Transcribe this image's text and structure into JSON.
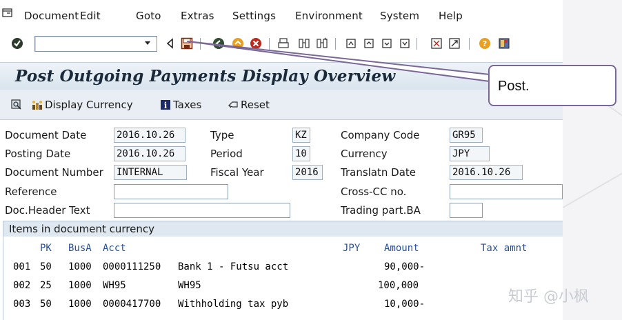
{
  "menu": {
    "items": [
      {
        "label": "Document"
      },
      {
        "label": "Edit"
      },
      {
        "label": "Goto"
      },
      {
        "label": "Extras"
      },
      {
        "label": "Settings"
      },
      {
        "label": "Environment"
      },
      {
        "label": "System"
      },
      {
        "label": "Help"
      }
    ]
  },
  "toolbar": {
    "command_value": ""
  },
  "title": "Post Outgoing Payments Display Overview",
  "app_toolbar": {
    "display_currency": "Display Currency",
    "taxes": "Taxes",
    "reset": "Reset"
  },
  "header": {
    "document_date_label": "Document Date",
    "document_date": "2016.10.26",
    "posting_date_label": "Posting Date",
    "posting_date": "2016.10.26",
    "document_number_label": "Document Number",
    "document_number": "INTERNAL",
    "reference_label": "Reference",
    "reference": "",
    "doc_header_text_label": "Doc.Header Text",
    "doc_header_text": "",
    "type_label": "Type",
    "type": "KZ",
    "period_label": "Period",
    "period": "10",
    "fiscal_year_label": "Fiscal Year",
    "fiscal_year": "2016",
    "company_code_label": "Company Code",
    "company_code": "GR95",
    "currency_label": "Currency",
    "currency": "JPY",
    "translatn_date_label": "Translatn Date",
    "translatn_date": "2016.10.26",
    "cross_cc_label": "Cross-CC no.",
    "cross_cc": "",
    "trading_part_label": "Trading part.BA",
    "trading_part": ""
  },
  "items": {
    "title": "Items in document currency",
    "columns": {
      "pk": "PK",
      "busa": "BusA",
      "acct": "Acct",
      "curr": "JPY",
      "amount": "Amount",
      "tax": "Tax amnt"
    },
    "rows": [
      {
        "no": "001",
        "pk": "50",
        "busa": "1000",
        "acct": "0000111250",
        "text": "Bank 1 - Futsu acct",
        "amount": "90,000-"
      },
      {
        "no": "002",
        "pk": "25",
        "busa": "1000",
        "acct": "WH95",
        "text": "WH95",
        "amount": "100,000"
      },
      {
        "no": "003",
        "pk": "50",
        "busa": "1000",
        "acct": "0000417700",
        "text": "Withholding tax pyb",
        "amount": "10,000-"
      }
    ]
  },
  "callout": {
    "text": "Post."
  },
  "watermark": "知乎 @小枫"
}
